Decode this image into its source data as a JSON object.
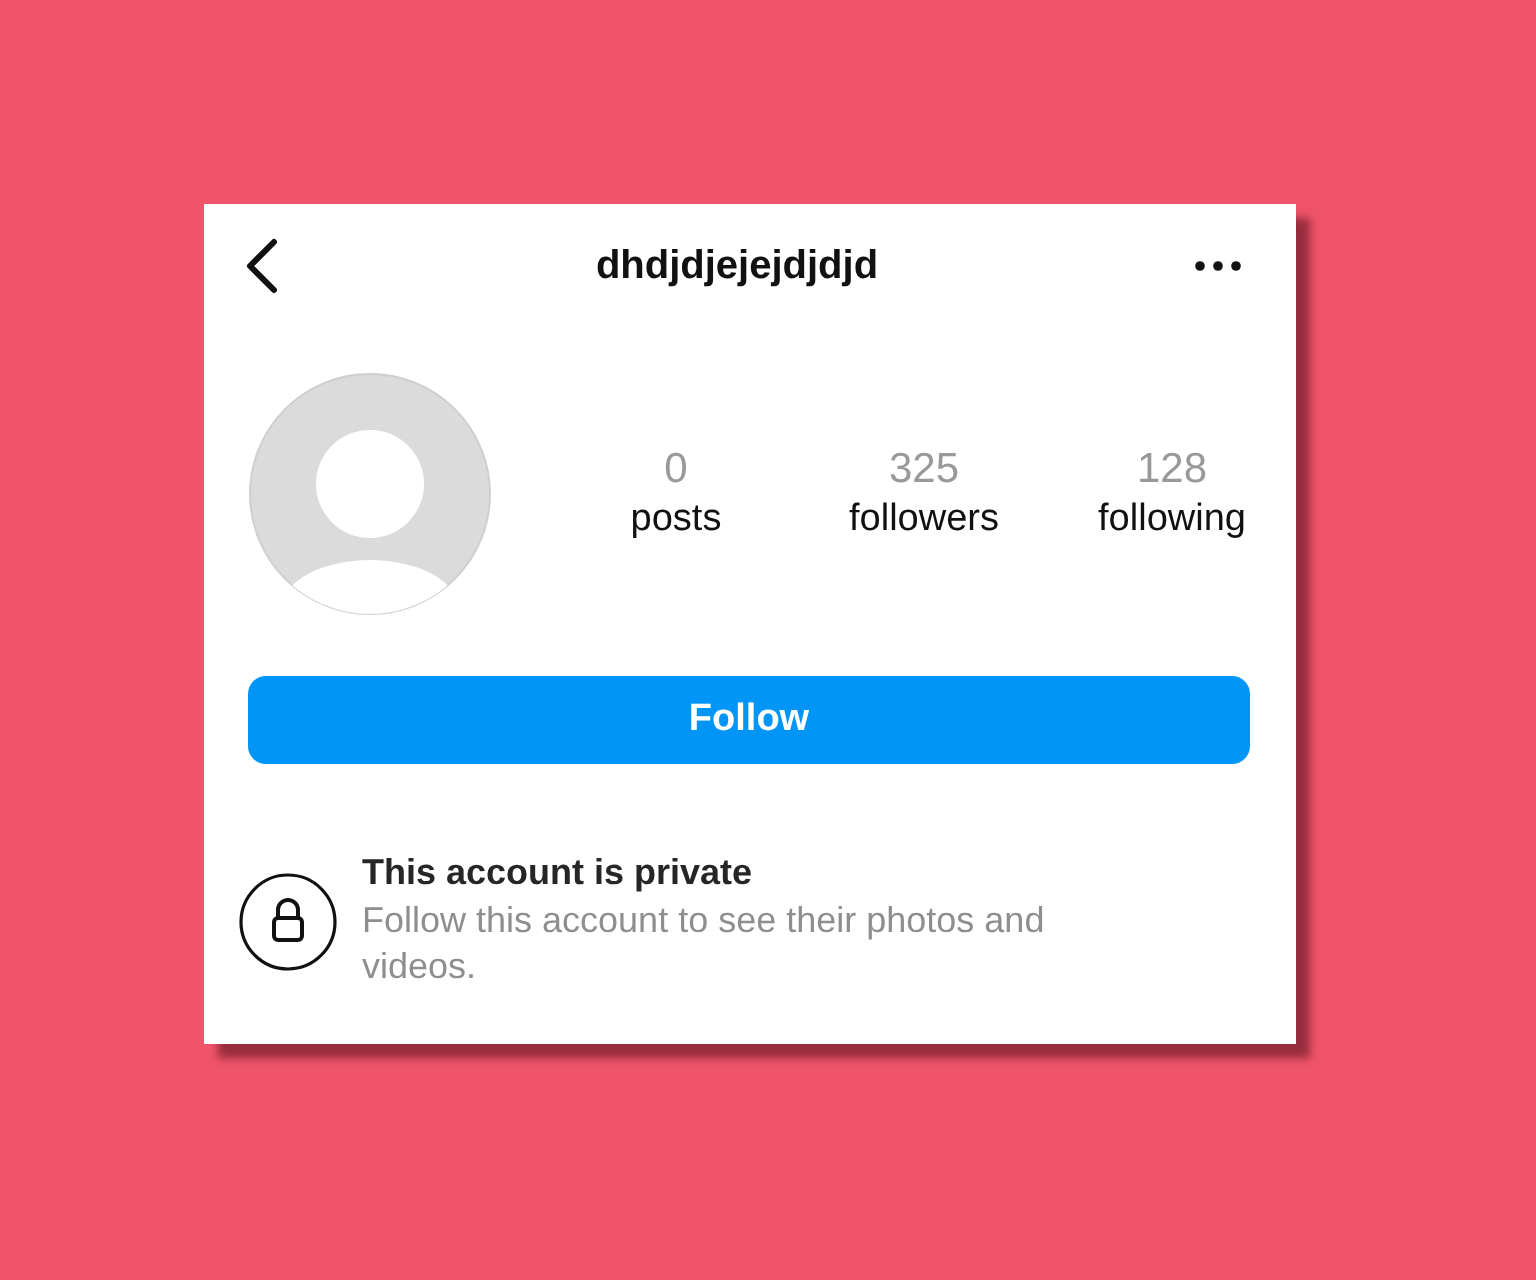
{
  "header": {
    "username": "dhdjdjejejdjdjd"
  },
  "stats": [
    {
      "value": "0",
      "label": "posts"
    },
    {
      "value": "325",
      "label": "followers"
    },
    {
      "value": "128",
      "label": "following"
    }
  ],
  "follow_button": {
    "label": "Follow"
  },
  "private_notice": {
    "title": "This account is private",
    "text": "Follow this account to see their photos and videos."
  }
}
